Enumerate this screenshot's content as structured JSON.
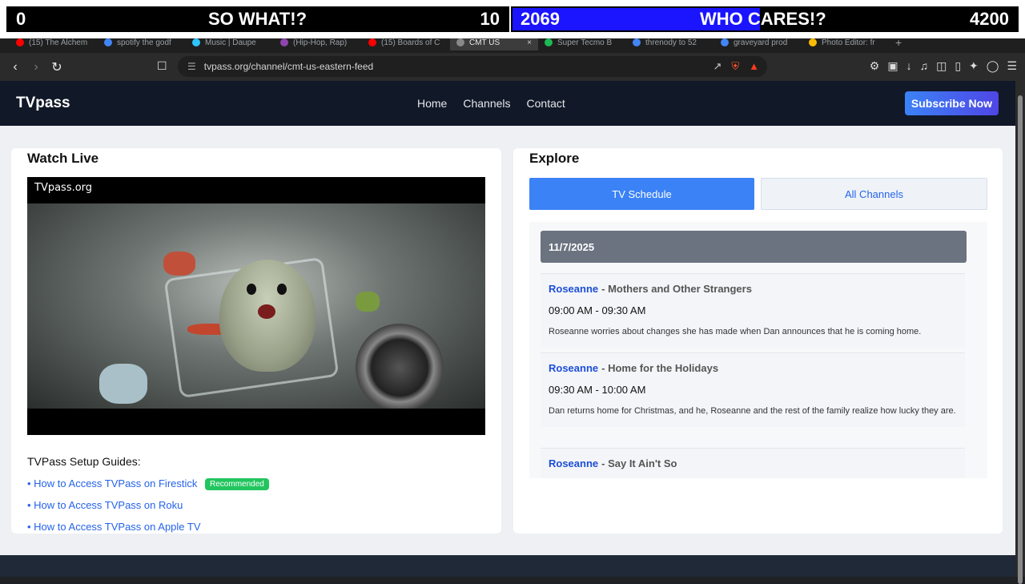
{
  "overlay": {
    "left": {
      "score_a": "0",
      "label": "SO WHAT!?",
      "score_b": "10"
    },
    "right": {
      "score_a": "2069",
      "label": "WHO CARES!?",
      "score_b": "4200",
      "fill_fraction": 0.49
    },
    "colors": {
      "left_bg": "#000000",
      "right_fill": "#1a14ff"
    }
  },
  "browser": {
    "tabs": [
      {
        "label": "(15) The Alchem",
        "icon": "youtube-icon",
        "color": "#ff0000"
      },
      {
        "label": "spotify the godf",
        "icon": "google-icon",
        "color": "#4285f4"
      },
      {
        "label": "Music | Daupe",
        "icon": "app-icon",
        "color": "#2ec4ff"
      },
      {
        "label": "(Hip-Hop, Rap)",
        "icon": "app-icon",
        "color": "#8e44ad"
      },
      {
        "label": "(15) Boards of C",
        "icon": "youtube-icon",
        "color": "#ff0000"
      },
      {
        "label": "CMT US",
        "icon": "globe-icon",
        "color": "#888888",
        "active": true
      },
      {
        "label": "Super Tecmo B",
        "icon": "spotify-icon",
        "color": "#1db954"
      },
      {
        "label": "threnody to 52",
        "icon": "google-icon",
        "color": "#4285f4"
      },
      {
        "label": "graveyard prod",
        "icon": "google-icon",
        "color": "#4285f4"
      },
      {
        "label": "Photo Editor: fr",
        "icon": "chrome-icon",
        "color": "#fbbc05"
      }
    ],
    "url": "tvpass.org/channel/cmt-us-eastern-feed"
  },
  "site": {
    "logo": "TVpass",
    "nav": [
      "Home",
      "Channels",
      "Contact"
    ],
    "subscribe": "Subscribe Now",
    "watch_title": "Watch Live",
    "player_label": "TVpass.org",
    "guides_title": "TVPass Setup Guides:",
    "guides": [
      {
        "label": "• How to Access TVPass on Firestick",
        "badge": "Recommended"
      },
      {
        "label": "• How to Access TVPass on Roku"
      },
      {
        "label": "• How to Access TVPass on Apple TV"
      }
    ],
    "explore_title": "Explore",
    "tabs": [
      "TV Schedule",
      "All Channels"
    ],
    "schedule": {
      "date": "11/7/2025",
      "items": [
        {
          "show": "Roseanne",
          "episode": "- Mothers and Other Strangers",
          "time": "09:00 AM - 09:30 AM",
          "desc": "Roseanne worries about changes she has made when Dan announces that he is coming home."
        },
        {
          "show": "Roseanne",
          "episode": "- Home for the Holidays",
          "time": "09:30 AM - 10:00 AM",
          "desc": "Dan returns home for Christmas, and he, Roseanne and the rest of the family realize how lucky they are."
        },
        {
          "show": "Roseanne",
          "episode": "- Say It Ain't So",
          "time": "",
          "desc": ""
        }
      ]
    }
  }
}
